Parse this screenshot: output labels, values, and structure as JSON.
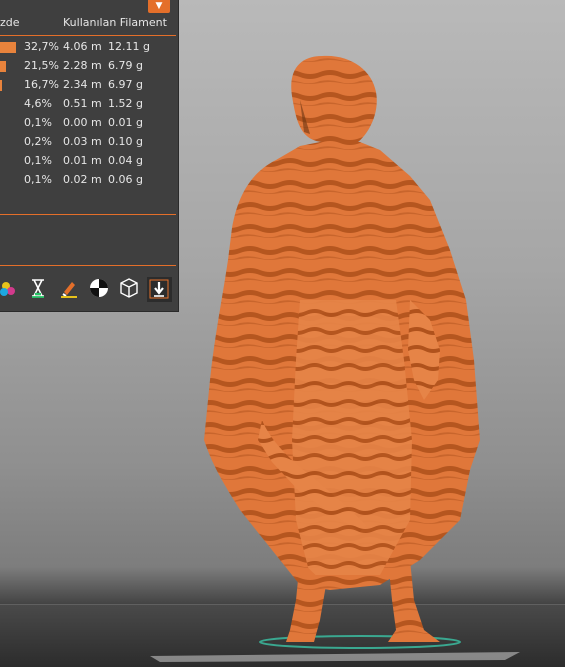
{
  "panel": {
    "dropdown_glyph": "▼",
    "header_pct": "zde",
    "header_filament": "Kullanılan Filament",
    "rows": [
      {
        "pct": "32,7%",
        "length": "4.06 m",
        "weight": "12.11 g",
        "bar_fraction": 1.0
      },
      {
        "pct": "21,5%",
        "length": "2.28 m",
        "weight": "6.79 g",
        "bar_fraction": 0.4
      },
      {
        "pct": "16,7%",
        "length": "2.34 m",
        "weight": "6.97 g",
        "bar_fraction": 0.15
      },
      {
        "pct": "4,6%",
        "length": "0.51 m",
        "weight": "1.52 g",
        "bar_fraction": 0
      },
      {
        "pct": "0,1%",
        "length": "0.00 m",
        "weight": "0.01 g",
        "bar_fraction": 0
      },
      {
        "pct": "0,2%",
        "length": "0.03 m",
        "weight": "0.10 g",
        "bar_fraction": 0
      },
      {
        "pct": "0,1%",
        "length": "0.01 m",
        "weight": "0.04 g",
        "bar_fraction": 0
      },
      {
        "pct": "0,1%",
        "length": "0.02 m",
        "weight": "0.06 g",
        "bar_fraction": 0
      }
    ],
    "toolbar_icons": [
      "color-print-icon",
      "print-time-icon",
      "paint-tool-icon",
      "layer-height-icon",
      "bounding-box-icon",
      "export-down-icon"
    ]
  },
  "colors": {
    "accent": "#e46f2a",
    "model": "#e07a3e",
    "model_dark": "#b35a26",
    "panel_bg": "#3f3f3f"
  }
}
